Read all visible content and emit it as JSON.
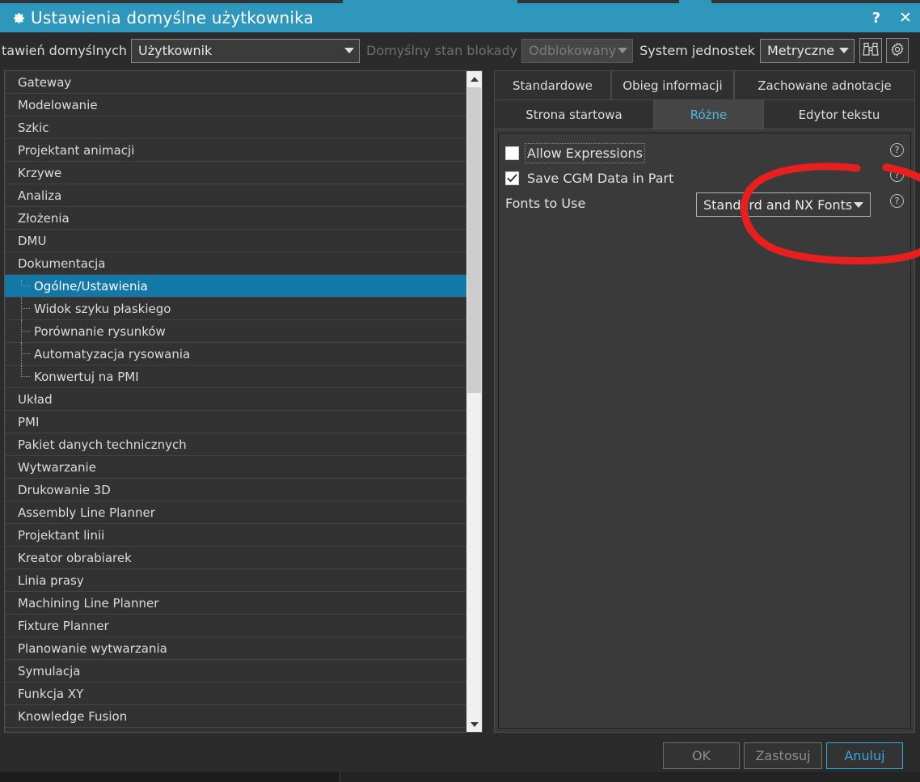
{
  "window": {
    "title": "Ustawienia domyślne użytkownika",
    "gear_icon": "gear-icon",
    "help_button": "?",
    "close_button": "✕"
  },
  "toolbar": {
    "settings_label": "tawień domyślnych",
    "settings_value": "Użytkownik",
    "lock_label": "Domyślny stan blokady",
    "lock_value": "Odblokowany",
    "units_label": "System jednostek",
    "units_value": "Metryczne",
    "find_icon": "binoculars-icon",
    "options_icon": "gear-icon"
  },
  "sidebar": {
    "items": [
      {
        "label": "Gateway",
        "level": 0
      },
      {
        "label": "Modelowanie",
        "level": 0
      },
      {
        "label": "Szkic",
        "level": 0
      },
      {
        "label": "Projektant animacji",
        "level": 0
      },
      {
        "label": "Krzywe",
        "level": 0
      },
      {
        "label": "Analiza",
        "level": 0
      },
      {
        "label": "Złożenia",
        "level": 0
      },
      {
        "label": "DMU",
        "level": 0
      },
      {
        "label": "Dokumentacja",
        "level": 0
      },
      {
        "label": "Ogólne/Ustawienia",
        "level": 1,
        "selected": true
      },
      {
        "label": "Widok szyku płaskiego",
        "level": 1
      },
      {
        "label": "Porównanie rysunków",
        "level": 1
      },
      {
        "label": "Automatyzacja rysowania",
        "level": 1
      },
      {
        "label": "Konwertuj na PMI",
        "level": 1,
        "last": true
      },
      {
        "label": "Układ",
        "level": 0
      },
      {
        "label": "PMI",
        "level": 0
      },
      {
        "label": "Pakiet danych technicznych",
        "level": 0
      },
      {
        "label": "Wytwarzanie",
        "level": 0
      },
      {
        "label": "Drukowanie 3D",
        "level": 0
      },
      {
        "label": "Assembly Line Planner",
        "level": 0
      },
      {
        "label": "Projektant linii",
        "level": 0
      },
      {
        "label": "Kreator obrabiarek",
        "level": 0
      },
      {
        "label": "Linia prasy",
        "level": 0
      },
      {
        "label": "Machining Line Planner",
        "level": 0
      },
      {
        "label": "Fixture Planner",
        "level": 0
      },
      {
        "label": "Planowanie wytwarzania",
        "level": 0
      },
      {
        "label": "Symulacja",
        "level": 0
      },
      {
        "label": "Funkcja XY",
        "level": 0
      },
      {
        "label": "Knowledge Fusion",
        "level": 0
      }
    ],
    "scroll_up_icon": "chevron-up-icon",
    "scroll_down_icon": "chevron-down-icon"
  },
  "tabs": {
    "row1": [
      {
        "label": "Standardowe",
        "active": false
      },
      {
        "label": "Obieg informacji",
        "active": false
      },
      {
        "label": "Zachowane adnotacje",
        "active": false
      }
    ],
    "row2": [
      {
        "label": "Strona startowa",
        "active": false
      },
      {
        "label": "Różne",
        "active": true
      },
      {
        "label": "Edytor tekstu",
        "active": false
      }
    ]
  },
  "panel": {
    "options": [
      {
        "label": "Allow Expressions",
        "checked": false,
        "focused": true
      },
      {
        "label": "Save CGM Data in Part",
        "checked": true,
        "focused": false
      }
    ],
    "fonts_label": "Fonts to Use",
    "fonts_value": "Standard and NX Fonts",
    "help_icon": "?"
  },
  "annotation": {
    "shape": "red-ellipse-highlight",
    "color": "#e81f1f"
  },
  "footer": {
    "ok": "OK",
    "apply": "Zastosuj",
    "cancel": "Anuluj"
  },
  "colors": {
    "title_bar": "#2f97bb",
    "accent": "#35a8d8",
    "selection": "#1378a8",
    "annotation": "#e81f1f"
  }
}
